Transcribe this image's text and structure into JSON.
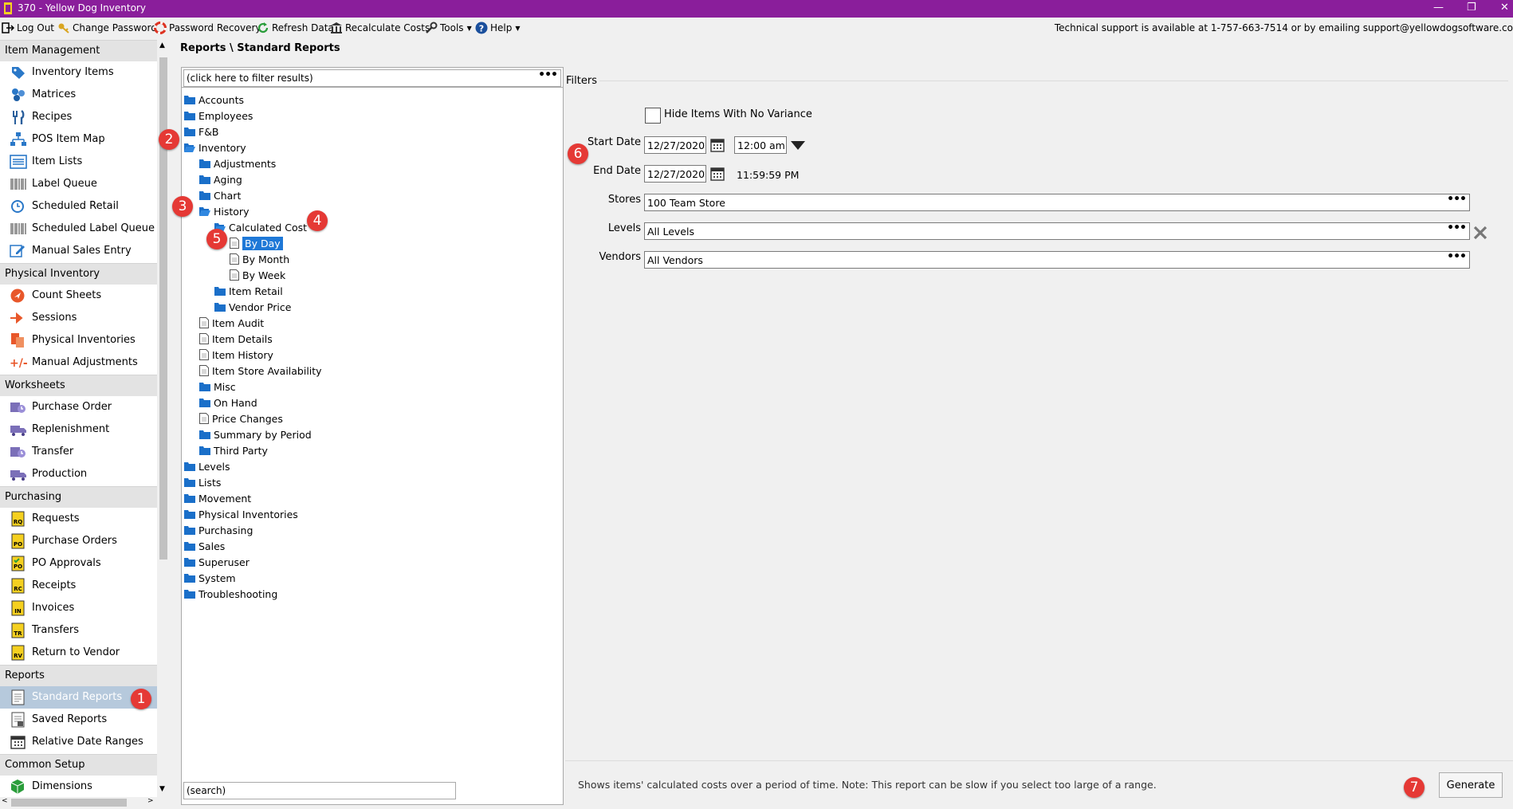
{
  "window": {
    "title": "370 - Yellow Dog Inventory"
  },
  "toolbar": {
    "logout": "Log Out",
    "change_password": "Change Password",
    "password_recovery": "Password Recovery",
    "refresh_data": "Refresh Data",
    "recalculate_costs": "Recalculate Costs",
    "tools": "Tools",
    "help": "Help",
    "support": "Technical support is available at 1-757-663-7514 or by emailing support@yellowdogsoftware.co"
  },
  "sidebar": {
    "sections": [
      {
        "label": "Item Management"
      },
      {
        "label": "Physical Inventory"
      },
      {
        "label": "Worksheets"
      },
      {
        "label": "Purchasing"
      },
      {
        "label": "Reports"
      },
      {
        "label": "Common Setup"
      }
    ],
    "items": [
      {
        "label": "Inventory Items",
        "icon": "tag-icon"
      },
      {
        "label": "Matrices",
        "icon": "matrix-icon"
      },
      {
        "label": "Recipes",
        "icon": "fork-knife-icon"
      },
      {
        "label": "POS Item Map",
        "icon": "hierarchy-icon"
      },
      {
        "label": "Item Lists",
        "icon": "list-icon"
      },
      {
        "label": "Label Queue",
        "icon": "barcode-icon"
      },
      {
        "label": "Scheduled Retail",
        "icon": "clock-icon"
      },
      {
        "label": "Scheduled Label Queue",
        "icon": "barcode-icon"
      },
      {
        "label": "Manual Sales Entry",
        "icon": "edit-icon"
      },
      {
        "label": "Count Sheets",
        "icon": "count-sheet-icon"
      },
      {
        "label": "Sessions",
        "icon": "sessions-icon"
      },
      {
        "label": "Physical Inventories",
        "icon": "physical-inventory-icon"
      },
      {
        "label": "Manual Adjustments",
        "icon": "plus-minus-icon"
      },
      {
        "label": "Purchase Order",
        "icon": "worksheet-icon"
      },
      {
        "label": "Replenishment",
        "icon": "truck-icon"
      },
      {
        "label": "Transfer",
        "icon": "worksheet-icon"
      },
      {
        "label": "Production",
        "icon": "truck-icon"
      },
      {
        "label": "Requests",
        "icon": "doc-rq-icon",
        "code": "RQ"
      },
      {
        "label": "Purchase Orders",
        "icon": "doc-po-icon",
        "code": "PO"
      },
      {
        "label": "PO Approvals",
        "icon": "doc-po-approval-icon",
        "code": "PO"
      },
      {
        "label": "Receipts",
        "icon": "doc-rc-icon",
        "code": "RC"
      },
      {
        "label": "Invoices",
        "icon": "doc-in-icon",
        "code": "IN"
      },
      {
        "label": "Transfers",
        "icon": "doc-tr-icon",
        "code": "TR"
      },
      {
        "label": "Return to Vendor",
        "icon": "doc-rv-icon",
        "code": "RV"
      },
      {
        "label": "Standard Reports",
        "icon": "report-icon"
      },
      {
        "label": "Saved Reports",
        "icon": "saved-report-icon"
      },
      {
        "label": "Relative Date Ranges",
        "icon": "calendar-icon"
      },
      {
        "label": "Dimensions",
        "icon": "cube-icon"
      }
    ]
  },
  "breadcrumb": "Reports \\ Standard Reports",
  "tree": {
    "filter_placeholder": "(click here to filter results)",
    "search_placeholder": "(search)",
    "nodes": [
      {
        "label": "Accounts"
      },
      {
        "label": "Employees"
      },
      {
        "label": "F&B"
      },
      {
        "label": "Inventory"
      },
      {
        "label": "Adjustments"
      },
      {
        "label": "Aging"
      },
      {
        "label": "Chart"
      },
      {
        "label": "History"
      },
      {
        "label": "Calculated Cost"
      },
      {
        "label": "By Day"
      },
      {
        "label": "By Month"
      },
      {
        "label": "By Week"
      },
      {
        "label": "Item Retail"
      },
      {
        "label": "Vendor Price"
      },
      {
        "label": "Item Audit"
      },
      {
        "label": "Item Details"
      },
      {
        "label": "Item History"
      },
      {
        "label": "Item Store Availability"
      },
      {
        "label": "Misc"
      },
      {
        "label": "On Hand"
      },
      {
        "label": "Price Changes"
      },
      {
        "label": "Summary by Period"
      },
      {
        "label": "Third Party"
      },
      {
        "label": "Levels"
      },
      {
        "label": "Lists"
      },
      {
        "label": "Movement"
      },
      {
        "label": "Physical Inventories"
      },
      {
        "label": "Purchasing"
      },
      {
        "label": "Sales"
      },
      {
        "label": "Superuser"
      },
      {
        "label": "System"
      },
      {
        "label": "Troubleshooting"
      }
    ]
  },
  "filters": {
    "title": "Filters",
    "hide_no_variance": "Hide Items With No Variance",
    "start_date_label": "Start Date",
    "start_date": "12/27/2020",
    "start_time": "12:00 am",
    "end_date_label": "End Date",
    "end_date": "12/27/2020",
    "end_time": "11:59:59 PM",
    "stores_label": "Stores",
    "stores": "100 Team Store",
    "levels_label": "Levels",
    "levels": "All Levels",
    "vendors_label": "Vendors",
    "vendors": "All Vendors"
  },
  "footer": {
    "description": "Shows items' calculated costs over a period of time. Note: This report can be slow if you select too large of a range.",
    "generate": "Generate"
  },
  "badges": [
    "1",
    "2",
    "3",
    "4",
    "5",
    "6",
    "7"
  ],
  "colors": {
    "titlebar": "#8a1e9b",
    "selection": "#1e78d7",
    "folder": "#1a6fc9",
    "badge": "#e53935"
  }
}
